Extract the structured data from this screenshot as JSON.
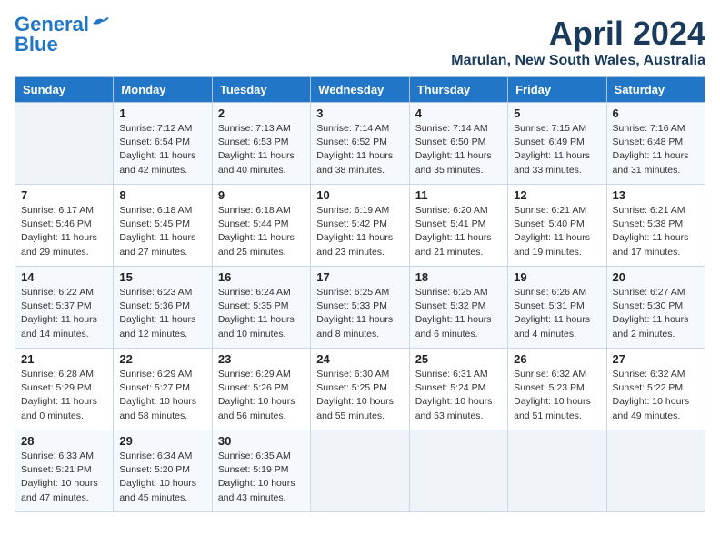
{
  "header": {
    "logo_line1": "General",
    "logo_line2": "Blue",
    "month": "April 2024",
    "location": "Marulan, New South Wales, Australia"
  },
  "days_of_week": [
    "Sunday",
    "Monday",
    "Tuesday",
    "Wednesday",
    "Thursday",
    "Friday",
    "Saturday"
  ],
  "weeks": [
    [
      {
        "day": "",
        "sunrise": "",
        "sunset": "",
        "daylight": ""
      },
      {
        "day": "1",
        "sunrise": "Sunrise: 7:12 AM",
        "sunset": "Sunset: 6:54 PM",
        "daylight": "Daylight: 11 hours and 42 minutes."
      },
      {
        "day": "2",
        "sunrise": "Sunrise: 7:13 AM",
        "sunset": "Sunset: 6:53 PM",
        "daylight": "Daylight: 11 hours and 40 minutes."
      },
      {
        "day": "3",
        "sunrise": "Sunrise: 7:14 AM",
        "sunset": "Sunset: 6:52 PM",
        "daylight": "Daylight: 11 hours and 38 minutes."
      },
      {
        "day": "4",
        "sunrise": "Sunrise: 7:14 AM",
        "sunset": "Sunset: 6:50 PM",
        "daylight": "Daylight: 11 hours and 35 minutes."
      },
      {
        "day": "5",
        "sunrise": "Sunrise: 7:15 AM",
        "sunset": "Sunset: 6:49 PM",
        "daylight": "Daylight: 11 hours and 33 minutes."
      },
      {
        "day": "6",
        "sunrise": "Sunrise: 7:16 AM",
        "sunset": "Sunset: 6:48 PM",
        "daylight": "Daylight: 11 hours and 31 minutes."
      }
    ],
    [
      {
        "day": "7",
        "sunrise": "Sunrise: 6:17 AM",
        "sunset": "Sunset: 5:46 PM",
        "daylight": "Daylight: 11 hours and 29 minutes."
      },
      {
        "day": "8",
        "sunrise": "Sunrise: 6:18 AM",
        "sunset": "Sunset: 5:45 PM",
        "daylight": "Daylight: 11 hours and 27 minutes."
      },
      {
        "day": "9",
        "sunrise": "Sunrise: 6:18 AM",
        "sunset": "Sunset: 5:44 PM",
        "daylight": "Daylight: 11 hours and 25 minutes."
      },
      {
        "day": "10",
        "sunrise": "Sunrise: 6:19 AM",
        "sunset": "Sunset: 5:42 PM",
        "daylight": "Daylight: 11 hours and 23 minutes."
      },
      {
        "day": "11",
        "sunrise": "Sunrise: 6:20 AM",
        "sunset": "Sunset: 5:41 PM",
        "daylight": "Daylight: 11 hours and 21 minutes."
      },
      {
        "day": "12",
        "sunrise": "Sunrise: 6:21 AM",
        "sunset": "Sunset: 5:40 PM",
        "daylight": "Daylight: 11 hours and 19 minutes."
      },
      {
        "day": "13",
        "sunrise": "Sunrise: 6:21 AM",
        "sunset": "Sunset: 5:38 PM",
        "daylight": "Daylight: 11 hours and 17 minutes."
      }
    ],
    [
      {
        "day": "14",
        "sunrise": "Sunrise: 6:22 AM",
        "sunset": "Sunset: 5:37 PM",
        "daylight": "Daylight: 11 hours and 14 minutes."
      },
      {
        "day": "15",
        "sunrise": "Sunrise: 6:23 AM",
        "sunset": "Sunset: 5:36 PM",
        "daylight": "Daylight: 11 hours and 12 minutes."
      },
      {
        "day": "16",
        "sunrise": "Sunrise: 6:24 AM",
        "sunset": "Sunset: 5:35 PM",
        "daylight": "Daylight: 11 hours and 10 minutes."
      },
      {
        "day": "17",
        "sunrise": "Sunrise: 6:25 AM",
        "sunset": "Sunset: 5:33 PM",
        "daylight": "Daylight: 11 hours and 8 minutes."
      },
      {
        "day": "18",
        "sunrise": "Sunrise: 6:25 AM",
        "sunset": "Sunset: 5:32 PM",
        "daylight": "Daylight: 11 hours and 6 minutes."
      },
      {
        "day": "19",
        "sunrise": "Sunrise: 6:26 AM",
        "sunset": "Sunset: 5:31 PM",
        "daylight": "Daylight: 11 hours and 4 minutes."
      },
      {
        "day": "20",
        "sunrise": "Sunrise: 6:27 AM",
        "sunset": "Sunset: 5:30 PM",
        "daylight": "Daylight: 11 hours and 2 minutes."
      }
    ],
    [
      {
        "day": "21",
        "sunrise": "Sunrise: 6:28 AM",
        "sunset": "Sunset: 5:29 PM",
        "daylight": "Daylight: 11 hours and 0 minutes."
      },
      {
        "day": "22",
        "sunrise": "Sunrise: 6:29 AM",
        "sunset": "Sunset: 5:27 PM",
        "daylight": "Daylight: 10 hours and 58 minutes."
      },
      {
        "day": "23",
        "sunrise": "Sunrise: 6:29 AM",
        "sunset": "Sunset: 5:26 PM",
        "daylight": "Daylight: 10 hours and 56 minutes."
      },
      {
        "day": "24",
        "sunrise": "Sunrise: 6:30 AM",
        "sunset": "Sunset: 5:25 PM",
        "daylight": "Daylight: 10 hours and 55 minutes."
      },
      {
        "day": "25",
        "sunrise": "Sunrise: 6:31 AM",
        "sunset": "Sunset: 5:24 PM",
        "daylight": "Daylight: 10 hours and 53 minutes."
      },
      {
        "day": "26",
        "sunrise": "Sunrise: 6:32 AM",
        "sunset": "Sunset: 5:23 PM",
        "daylight": "Daylight: 10 hours and 51 minutes."
      },
      {
        "day": "27",
        "sunrise": "Sunrise: 6:32 AM",
        "sunset": "Sunset: 5:22 PM",
        "daylight": "Daylight: 10 hours and 49 minutes."
      }
    ],
    [
      {
        "day": "28",
        "sunrise": "Sunrise: 6:33 AM",
        "sunset": "Sunset: 5:21 PM",
        "daylight": "Daylight: 10 hours and 47 minutes."
      },
      {
        "day": "29",
        "sunrise": "Sunrise: 6:34 AM",
        "sunset": "Sunset: 5:20 PM",
        "daylight": "Daylight: 10 hours and 45 minutes."
      },
      {
        "day": "30",
        "sunrise": "Sunrise: 6:35 AM",
        "sunset": "Sunset: 5:19 PM",
        "daylight": "Daylight: 10 hours and 43 minutes."
      },
      {
        "day": "",
        "sunrise": "",
        "sunset": "",
        "daylight": ""
      },
      {
        "day": "",
        "sunrise": "",
        "sunset": "",
        "daylight": ""
      },
      {
        "day": "",
        "sunrise": "",
        "sunset": "",
        "daylight": ""
      },
      {
        "day": "",
        "sunrise": "",
        "sunset": "",
        "daylight": ""
      }
    ]
  ]
}
